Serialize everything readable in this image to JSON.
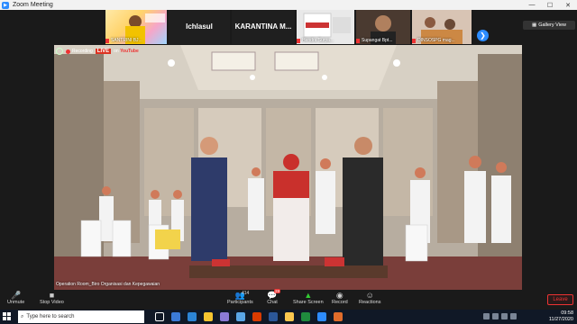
{
  "window": {
    "title": "Zoom Meeting",
    "minimize": "—",
    "maximize": "☐",
    "close": "✕"
  },
  "thumbnails": [
    {
      "name": "SANTRINI BJ..."
    },
    {
      "name": "Ichlasul"
    },
    {
      "name": "KARANTINA M..."
    },
    {
      "name": "Hendra Surya..."
    },
    {
      "name": "Supangat Bpt..."
    },
    {
      "name": "DINSOSPG mag..."
    }
  ],
  "gallery_view": "Gallery View",
  "next_page": "❯",
  "video": {
    "recording": "Recording",
    "live": "LIVE",
    "youtube_prefix": "on",
    "youtube": "YouTube",
    "participant_name": "Operation Room_Biro Organisasi dan Kepegawaian"
  },
  "toolbar": {
    "unmute": "Unmute",
    "stop_video": "Stop Video",
    "participants": "Participants",
    "participants_count": "414",
    "chat": "Chat",
    "chat_badge": "28",
    "share_screen": "Share Screen",
    "record": "Record",
    "reactions": "Reactions",
    "leave": "Leave"
  },
  "taskbar": {
    "search_placeholder": "Type here to search",
    "time": "09:58",
    "date": "11/27/2020"
  }
}
